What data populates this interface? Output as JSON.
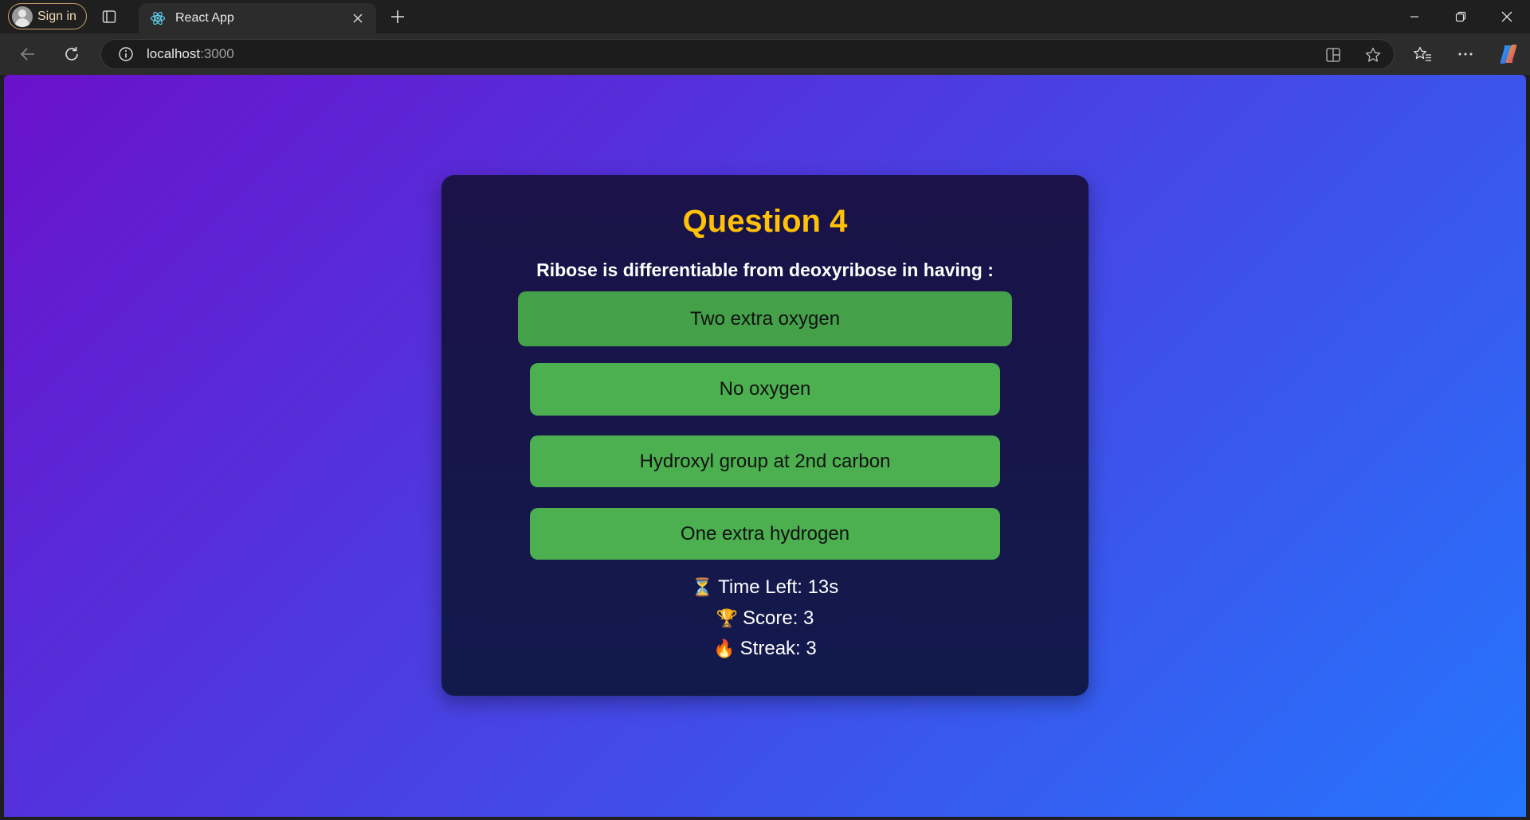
{
  "browser": {
    "signin_label": "Sign in",
    "tab_title": "React App",
    "url_host": "localhost",
    "url_port": ":3000",
    "icons": [
      "tab-actions-icon",
      "react-favicon-icon",
      "close-tab-icon",
      "new-tab-icon",
      "minimize-icon",
      "restore-icon",
      "close-window-icon",
      "back-icon",
      "refresh-icon",
      "site-info-icon",
      "split-screen-icon",
      "favorite-star-icon",
      "favorites-icon",
      "more-menu-icon",
      "copilot-icon"
    ]
  },
  "quiz": {
    "title": "Question 4",
    "question": "Ribose is differentiable from deoxyribose in having :",
    "options": [
      "Two extra oxygen",
      "No oxygen",
      "Hydroxyl group at 2nd carbon",
      "One extra hydrogen"
    ],
    "stats": {
      "time_icon": "⏳",
      "time_label": "Time Left: 13s",
      "score_icon": "🏆",
      "score_label": "Score: 3",
      "streak_icon": "🔥",
      "streak_label": "Streak: 3"
    }
  },
  "colors": {
    "gradient_start": "#6a11cb",
    "gradient_end": "#2575fc",
    "card_bg": "#151a4a",
    "title_color": "#ffc107",
    "option_bg": "#4caf50"
  }
}
